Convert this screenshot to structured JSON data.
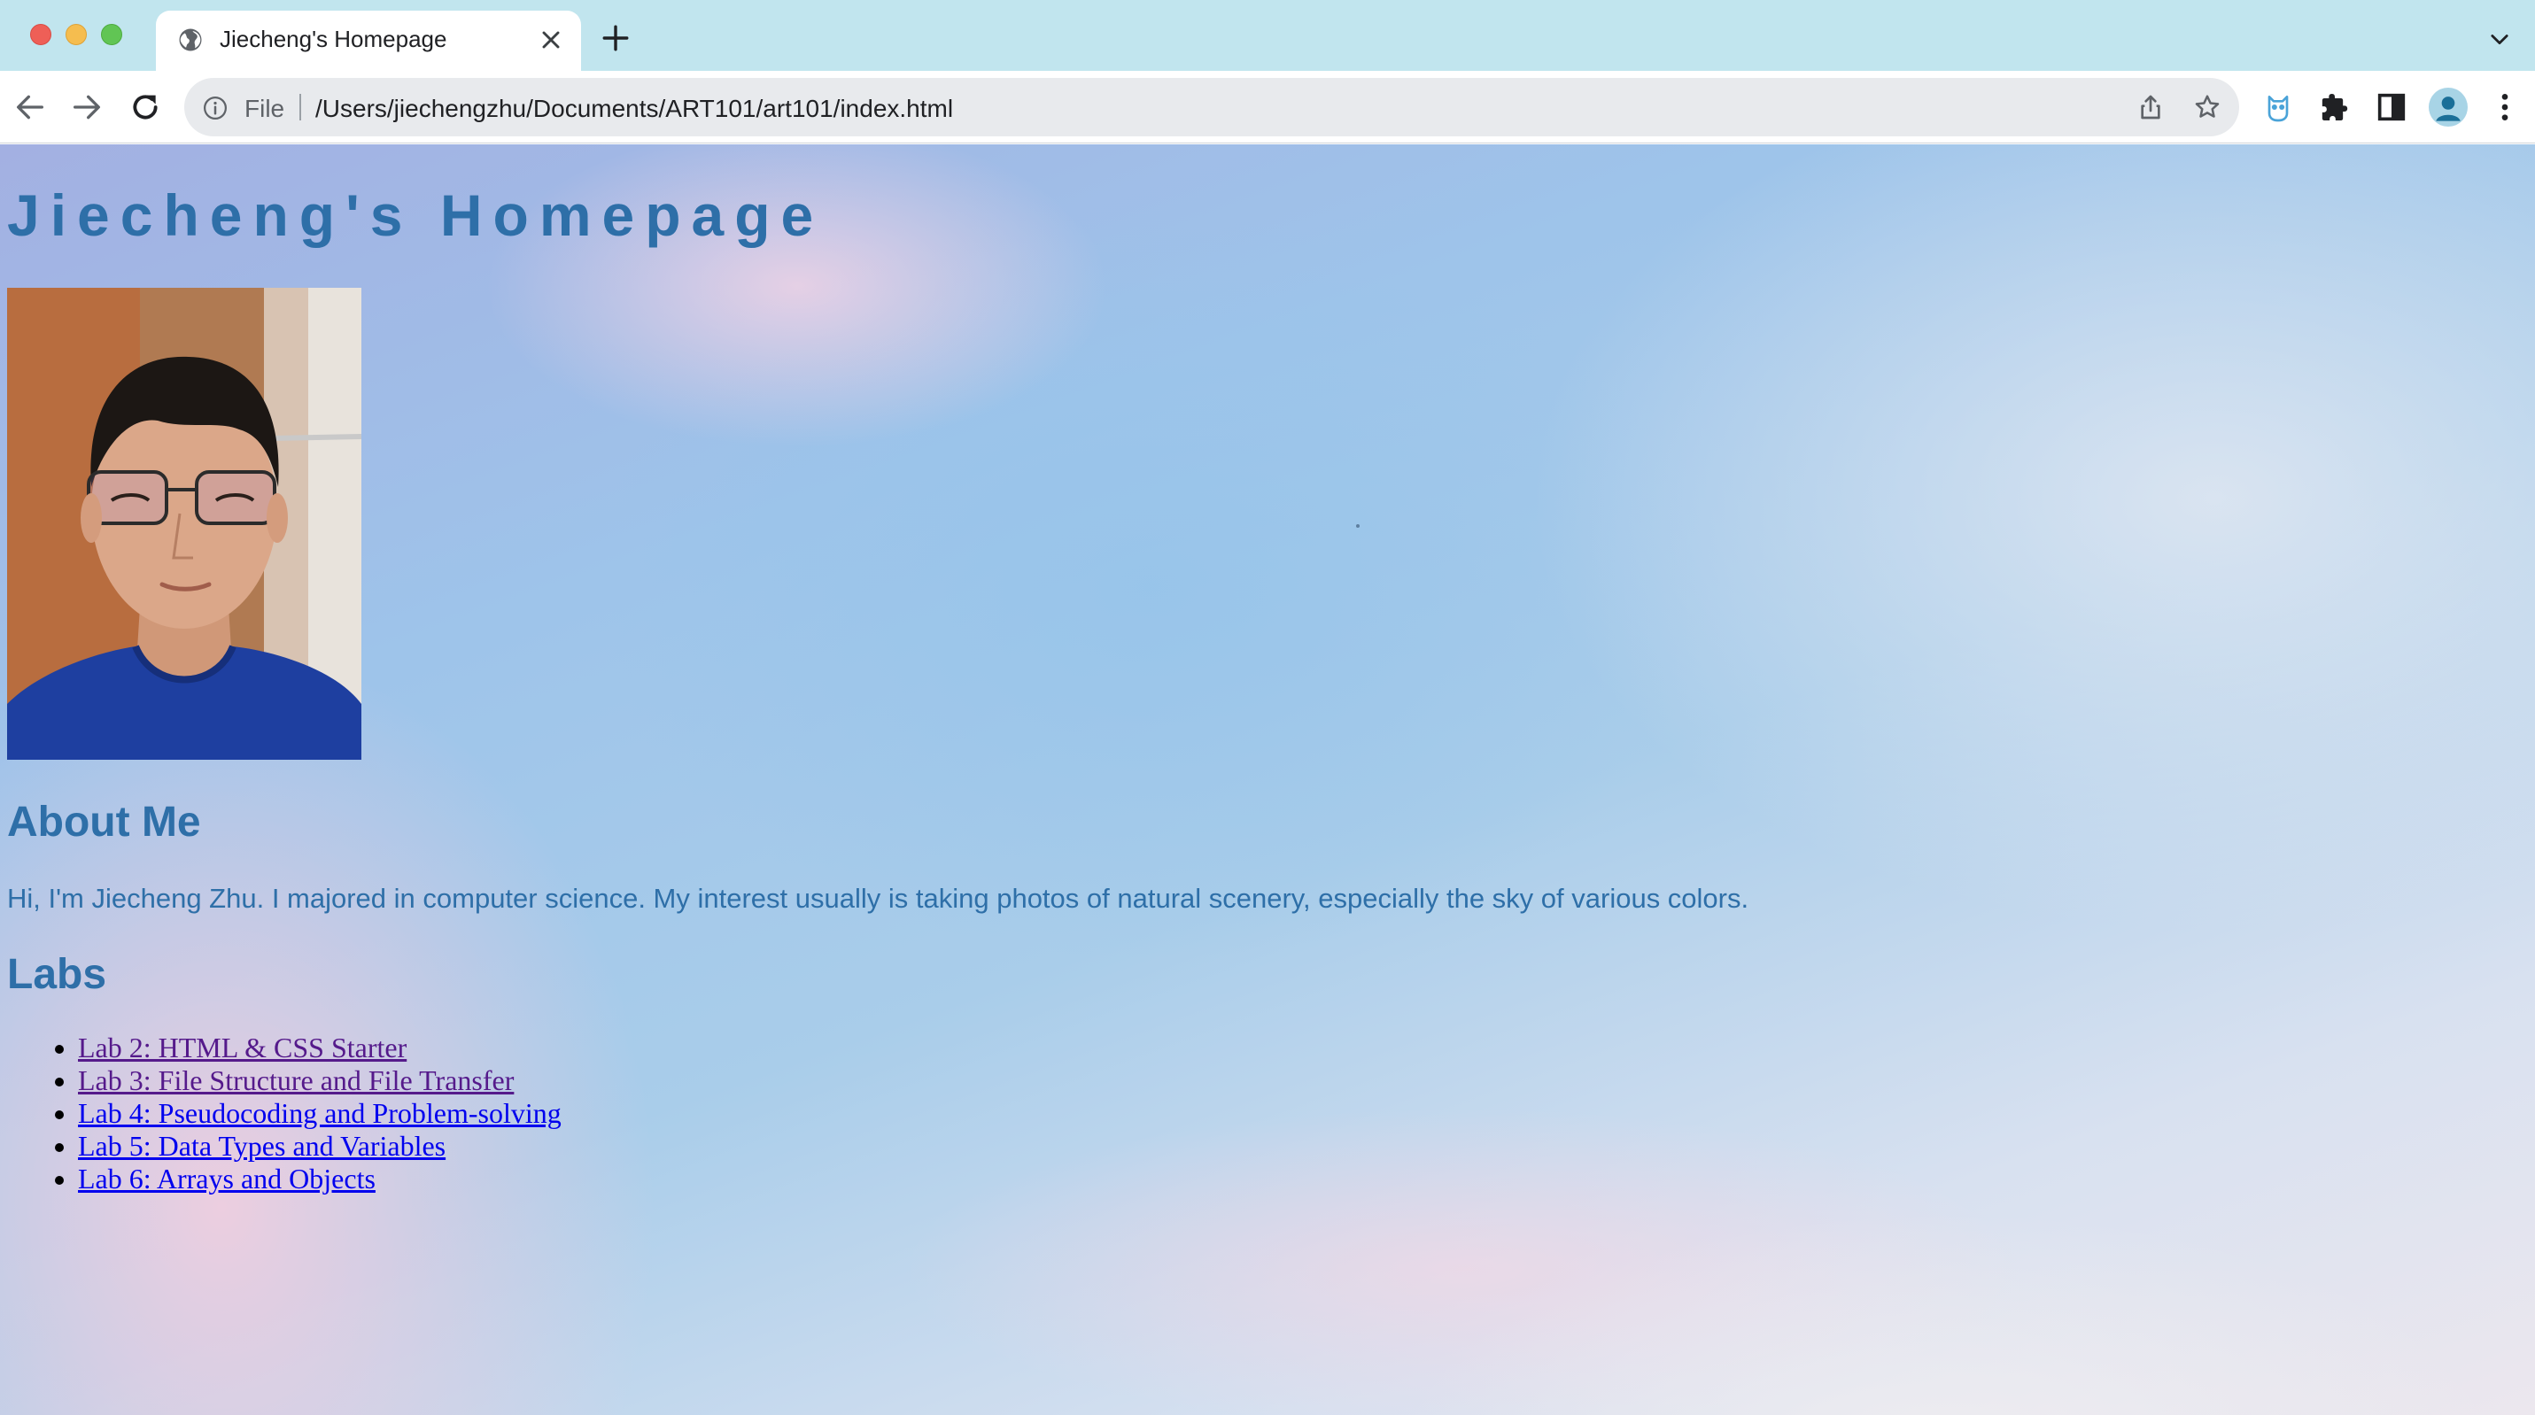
{
  "browser": {
    "tab": {
      "title": "Jiecheng's Homepage",
      "favicon": "globe-icon"
    },
    "address_bar": {
      "scheme_label": "File",
      "url": "/Users/jiechengzhu/Documents/ART101/art101/index.html"
    },
    "toolbar_icons": [
      "back-arrow-icon",
      "forward-arrow-icon",
      "reload-icon",
      "info-icon",
      "share-icon",
      "star-icon",
      "owl-extension-icon",
      "puzzle-icon",
      "side-panel-icon",
      "profile-avatar-icon",
      "kebab-menu-icon"
    ],
    "tab_strip_icons": [
      "close-icon",
      "plus-icon",
      "chevron-down-icon"
    ],
    "colors": {
      "tab_strip": "#c1e5ee",
      "omnibox": "#e8eaed"
    }
  },
  "page": {
    "title": "Jiecheng's Homepage",
    "photo": "profile-photo",
    "about": {
      "heading": "About Me",
      "text": "Hi, I'm Jiecheng Zhu. I majored in computer science. My interest usually is taking photos of natural scenery, especially the sky of various colors."
    },
    "labs": {
      "heading": "Labs",
      "items": [
        {
          "label": "Lab 2: HTML & CSS Starter",
          "visited": true
        },
        {
          "label": "Lab 3: File Structure and File Transfer",
          "visited": true
        },
        {
          "label": "Lab 4: Pseudocoding and Problem-solving",
          "visited": false
        },
        {
          "label": "Lab 5: Data Types and Variables",
          "visited": false
        },
        {
          "label": "Lab 6: Arrays and Objects",
          "visited": false
        }
      ]
    },
    "colors": {
      "text": "#2e6fa8",
      "link": "#0000ee",
      "visited_link": "#551a8b"
    }
  }
}
